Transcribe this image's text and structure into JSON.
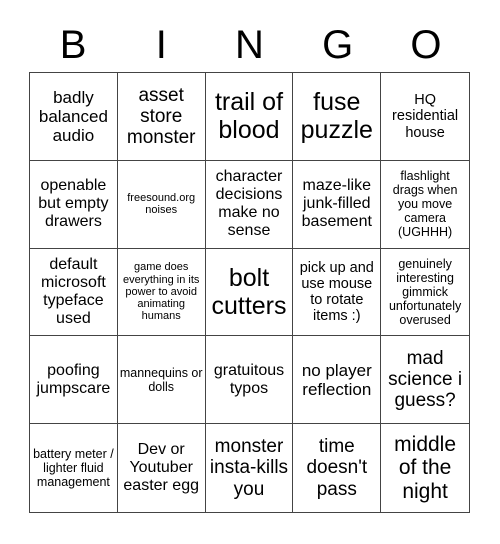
{
  "header": [
    "B",
    "I",
    "N",
    "G",
    "O"
  ],
  "cells": [
    "badly balanced audio",
    "asset store monster",
    "trail of blood",
    "fuse puzzle",
    "HQ residential house",
    "openable but empty drawers",
    "freesound.org noises",
    "character decisions make no sense",
    "maze-like junk-filled basement",
    "flashlight drags when you move camera (UGHHH)",
    "default microsoft typeface used",
    "game does everything in its power to avoid animating humans",
    "bolt cutters",
    "pick up and use mouse to rotate items :)",
    "genuinely interesting gimmick unfortunately overused",
    "poofing jumpscare",
    "mannequins or dolls",
    "gratuitous typos",
    "no player reflection",
    "mad science i guess?",
    "battery meter / lighter fluid management",
    "Dev or Youtuber easter egg",
    "monster insta-kills you",
    "time doesn't pass",
    "middle of the night"
  ]
}
